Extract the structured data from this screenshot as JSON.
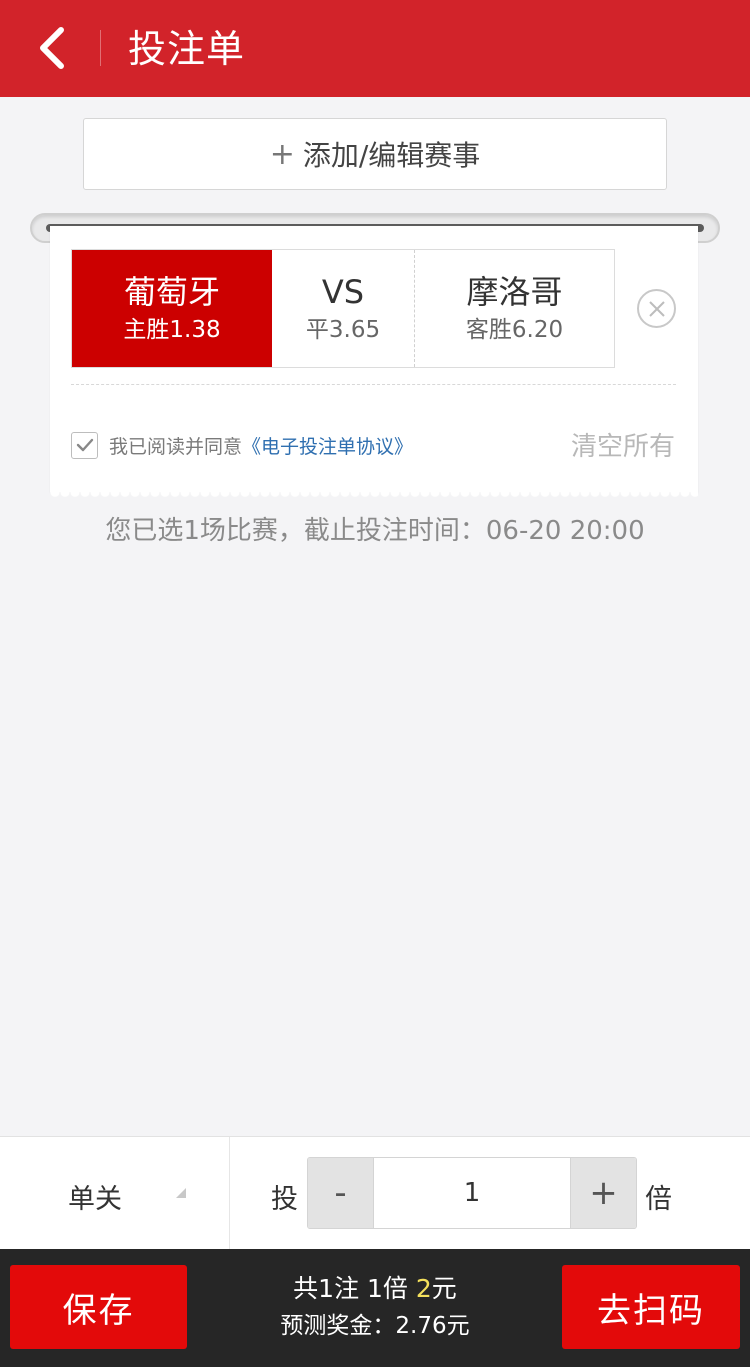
{
  "header": {
    "title": "投注单"
  },
  "add_button": {
    "plus": "+",
    "label": "添加/编辑赛事"
  },
  "match": {
    "home": {
      "name": "葡萄牙",
      "odds": "主胜1.38"
    },
    "draw": {
      "name": "VS",
      "odds": "平3.65"
    },
    "away": {
      "name": "摩洛哥",
      "odds": "客胜6.20"
    }
  },
  "agreement": {
    "text": "我已阅读并同意",
    "link": "《电子投注单协议》",
    "checked": true
  },
  "clear_all": "清空所有",
  "info_line": "您已选1场比赛，截止投注时间：06-20 20:00",
  "controls": {
    "mode": "单关",
    "tou": "投",
    "minus": "-",
    "plus": "+",
    "multiplier": "1",
    "bei": "倍"
  },
  "footer": {
    "save": "保存",
    "scan": "去扫码",
    "summary_prefix": "共1注 1倍 ",
    "summary_amount": "2",
    "summary_suffix": "元",
    "prize": "预测奖金：2.76元"
  },
  "colors": {
    "header": "#d2232a",
    "selected_team": "#cc0000",
    "button_red": "#e30a0a",
    "footer_bg": "#262626",
    "amount_highlight": "#f4e05c",
    "link_blue": "#2f6fb0"
  },
  "icons": {
    "back": "chevron-left-icon",
    "remove": "close-circle-icon",
    "check": "checkmark-icon",
    "caret": "caret-down-icon"
  }
}
